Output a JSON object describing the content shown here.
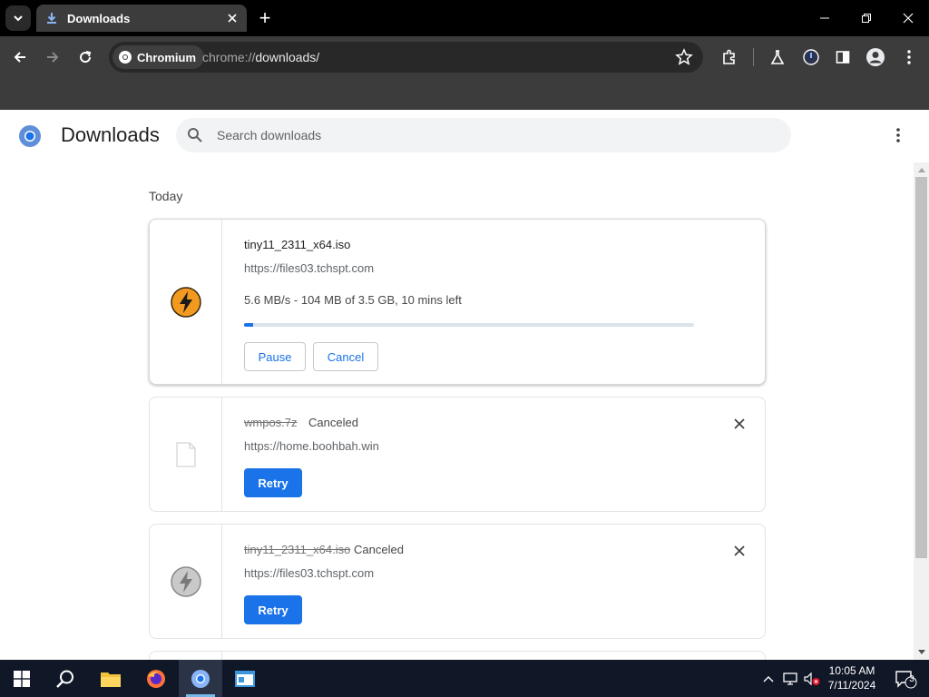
{
  "browser": {
    "tab_title": "Downloads",
    "new_tab_symbol": "+",
    "site_chip": "Chromium",
    "url_scheme": "chrome://",
    "url_path": "downloads/"
  },
  "page": {
    "title": "Downloads",
    "search_placeholder": "Search downloads",
    "section_label": "Today"
  },
  "downloads": [
    {
      "filename": "tiny11_2311_x64.iso",
      "source": "https://files03.tchspt.com",
      "progress_text": "5.6 MB/s - 104 MB of 3.5 GB, 10 mins left",
      "progress_fraction": 0.02,
      "pause_label": "Pause",
      "cancel_label": "Cancel",
      "icon": "lightning-bolt-icon"
    },
    {
      "filename": "wmpos.7z",
      "status": "Canceled",
      "source": "https://home.boohbah.win",
      "retry_label": "Retry",
      "icon": "file-icon"
    },
    {
      "filename": "tiny11_2311_x64.iso",
      "status": "Canceled",
      "source": "https://files03.tchspt.com",
      "retry_label": "Retry",
      "icon": "lightning-bolt-icon"
    }
  ],
  "taskbar": {
    "time": "10:05 AM",
    "date": "7/11/2024",
    "notification_count": "3"
  },
  "colors": {
    "accent": "#1a73e8",
    "toolbar": "#3c3c3c",
    "taskbar": "#101727"
  }
}
